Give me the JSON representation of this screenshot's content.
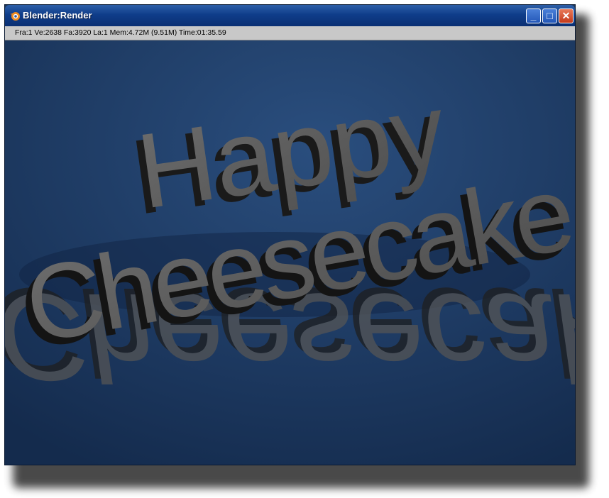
{
  "window": {
    "title": "Blender:Render",
    "minimize_label": "_",
    "maximize_label": "□",
    "close_label": "✕"
  },
  "statusbar": {
    "text": "Fra:1  Ve:2638 Fa:3920 La:1 Mem:4.72M (9.51M) Time:01:35.59"
  },
  "render": {
    "background_color": "#1d3a62",
    "text_color": "#5e5e5e",
    "line1": "Happy",
    "line2": "Cheesecake"
  },
  "icons": {
    "app": "blender-logo-icon",
    "minimize": "minimize-icon",
    "maximize": "maximize-icon",
    "close": "close-icon"
  }
}
